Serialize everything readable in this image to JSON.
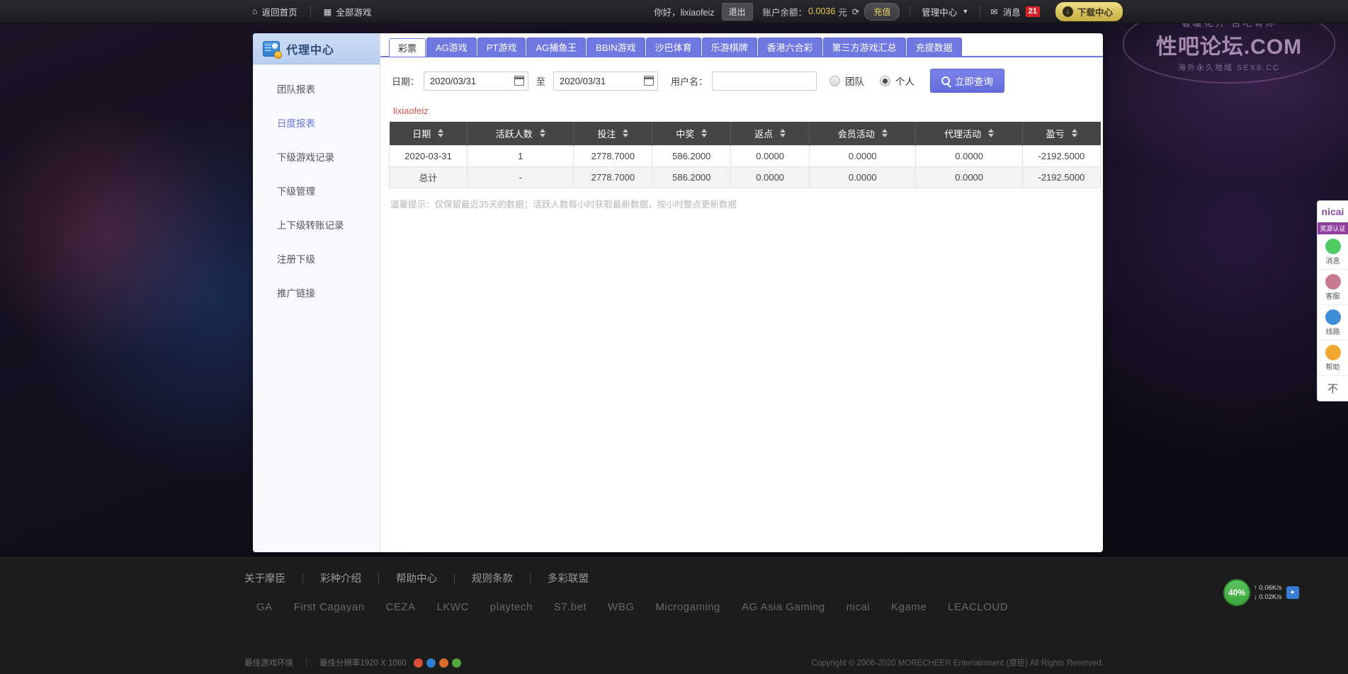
{
  "topbar": {
    "home": "返回首页",
    "all_games": "全部游戏",
    "greeting": "你好，lixiaofeiz",
    "logout": "退出",
    "balance_label": "账户余额：",
    "balance_value": "0.0036",
    "balance_unit": "元",
    "recharge": "充值",
    "management_center": "管理中心",
    "message": "消息",
    "message_count": "21",
    "download_center": "下载中心"
  },
  "watermark": {
    "top": "看暖花开 否吧有你",
    "main": "性吧论坛.COM",
    "bottom": "海外永久地域 SEX8.CC"
  },
  "sidebar": {
    "title": "代理中心",
    "items": [
      {
        "label": "团队报表",
        "active": false
      },
      {
        "label": "日度报表",
        "active": true
      },
      {
        "label": "下级游戏记录",
        "active": false
      },
      {
        "label": "下级管理",
        "active": false
      },
      {
        "label": "上下级转账记录",
        "active": false
      },
      {
        "label": "注册下级",
        "active": false
      },
      {
        "label": "推广链接",
        "active": false
      }
    ]
  },
  "tabs": [
    {
      "label": "彩票",
      "active": true
    },
    {
      "label": "AG游戏",
      "active": false
    },
    {
      "label": "PT游戏",
      "active": false
    },
    {
      "label": "AG捕鱼王",
      "active": false
    },
    {
      "label": "BBIN游戏",
      "active": false
    },
    {
      "label": "沙巴体育",
      "active": false
    },
    {
      "label": "乐游棋牌",
      "active": false
    },
    {
      "label": "香港六合彩",
      "active": false
    },
    {
      "label": "第三方游戏汇总",
      "active": false
    },
    {
      "label": "充提数据",
      "active": false
    }
  ],
  "filters": {
    "date_label": "日期：",
    "date_from": "2020/03/31",
    "date_to": "2020/03/31",
    "date_placeholder": "",
    "to_label": "至",
    "username_label": "用户名：",
    "username_value": "",
    "username_placeholder": "",
    "radio_team": "团队",
    "radio_personal": "个人",
    "selected_scope": "个人",
    "query_button": "立即查询"
  },
  "report": {
    "username": "lixiaofeiz",
    "columns": [
      "日期",
      "活跃人数",
      "投注",
      "中奖",
      "返点",
      "会员活动",
      "代理活动",
      "盈亏"
    ],
    "rows": [
      [
        "2020-03-31",
        "1",
        "2778.7000",
        "586.2000",
        "0.0000",
        "0.0000",
        "0.0000",
        "-2192.5000"
      ]
    ],
    "total_row": [
      "总计",
      "-",
      "2778.7000",
      "586.2000",
      "0.0000",
      "0.0000",
      "0.0000",
      "-2192.5000"
    ],
    "tip": "温馨提示：仅保留最近35天的数据；活跃人数每小时获取最新数据，按小时整点更新数据"
  },
  "footer": {
    "links": [
      "关于摩臣",
      "彩种介绍",
      "帮助中心",
      "规则条款",
      "多彩联盟"
    ],
    "partner_logos": [
      "GA",
      "First Cagayan",
      "CEZA",
      "LKWC",
      "playtech",
      "S7.bet",
      "WBG",
      "Microgaming",
      "AG Asia Gaming",
      "nicai",
      "Kgame",
      "LEACLOUD"
    ],
    "best_env": "最佳游戏环境",
    "best_res": "最佳分辨率1920 X 1080",
    "copyright": "Copyright © 2006-2020 MORECHEER Entertainment (摩臣) All Rights Reserved."
  },
  "float_widget": {
    "logo": "nicai",
    "subtitle": "奖源认证",
    "items": [
      {
        "label": "消息",
        "icon": "chat-icon",
        "color": "#4ecb63"
      },
      {
        "label": "客服",
        "icon": "service-icon",
        "color": "#c97a8f"
      },
      {
        "label": "线路",
        "icon": "route-icon",
        "color": "#3f8fd8"
      },
      {
        "label": "帮助",
        "icon": "help-icon",
        "color": "#f0a830"
      }
    ],
    "close": "不"
  },
  "speed_widget": {
    "percent": "40%",
    "up": "0.06K/s",
    "down": "0.02K/s"
  },
  "colors": {
    "tab_active": "#6f77e0",
    "accent": "#6a74d8",
    "table_header": "#454545",
    "username_red": "#d9534f",
    "balance_gold": "#e8c74a"
  }
}
